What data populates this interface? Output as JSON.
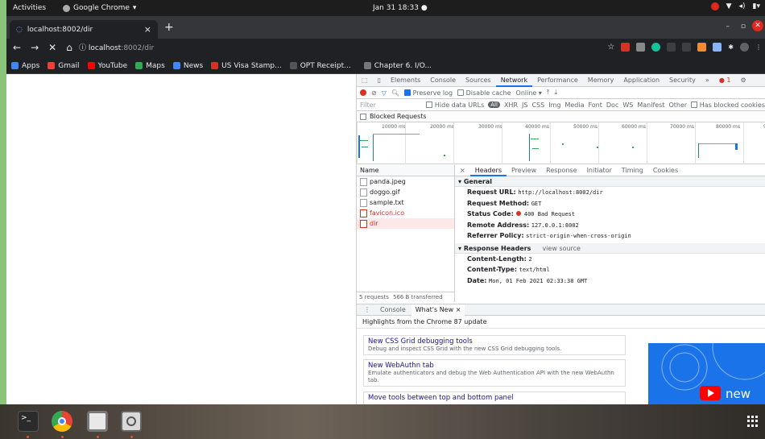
{
  "topbar": {
    "activities": "Activities",
    "app_name": "Google Chrome",
    "clock": "Jan 31  18:33"
  },
  "tab": {
    "title": "localhost:8002/dir",
    "close": "×",
    "new": "+"
  },
  "toolbar": {
    "back": "←",
    "forward": "→",
    "stop": "✕",
    "home": "⌂",
    "url_host": "localhost",
    "url_path": ":8002/dir"
  },
  "bookmarks": [
    {
      "label": "Apps",
      "color": "#4285f4"
    },
    {
      "label": "Gmail",
      "color": "#ea4335"
    },
    {
      "label": "YouTube",
      "color": "#ff0000"
    },
    {
      "label": "Maps",
      "color": "#34a853"
    },
    {
      "label": "News",
      "color": "#4285f4"
    },
    {
      "label": "US Visa Stamp...",
      "color": "#d93025"
    },
    {
      "label": "OPT Receipt...",
      "color": "#555555"
    },
    {
      "label": "Chapter 6. I/O...",
      "color": "#777777"
    }
  ],
  "devtools": {
    "tabs": [
      "Elements",
      "Console",
      "Sources",
      "Network",
      "Performance",
      "Memory",
      "Application",
      "Security",
      "»"
    ],
    "active_tab": "Network",
    "error_count": "1",
    "network_toolbar": {
      "preserve_log": "Preserve log",
      "disable_cache": "Disable cache",
      "throttle": "Online"
    },
    "filter": {
      "placeholder": "Filter",
      "hide_data_urls": "Hide data URLs",
      "all": "All",
      "types": [
        "XHR",
        "JS",
        "CSS",
        "Img",
        "Media",
        "Font",
        "Doc",
        "WS",
        "Manifest",
        "Other"
      ],
      "has_blocked": "Has blocked cookies"
    },
    "blocked_requests": "Blocked Requests",
    "timeline_ticks": [
      "10000 ms",
      "20000 ms",
      "30000 ms",
      "40000 ms",
      "50000 ms",
      "60000 ms",
      "70000 ms",
      "80000 ms",
      "9"
    ],
    "name_header": "Name",
    "requests": [
      {
        "name": "panda.jpeg",
        "error": false
      },
      {
        "name": "doggo.gif",
        "error": false
      },
      {
        "name": "sample.txt",
        "error": false
      },
      {
        "name": "favicon.ico",
        "error": true
      },
      {
        "name": "dir",
        "error": true
      }
    ],
    "summary_requests": "5 requests",
    "summary_transferred": "566 B transferred",
    "detail_tabs": [
      "×",
      "Headers",
      "Preview",
      "Response",
      "Initiator",
      "Timing",
      "Cookies"
    ],
    "general": {
      "title": "General",
      "request_url_k": "Request URL:",
      "request_url_v": "http://localhost:8002/dir",
      "method_k": "Request Method:",
      "method_v": "GET",
      "status_k": "Status Code:",
      "status_v": "400 Bad Request",
      "remote_k": "Remote Address:",
      "remote_v": "127.0.0.1:8002",
      "referrer_k": "Referrer Policy:",
      "referrer_v": "strict-origin-when-cross-origin"
    },
    "response_headers": {
      "title": "Response Headers",
      "view_source": "view source",
      "length_k": "Content-Length:",
      "length_v": "2",
      "type_k": "Content-Type:",
      "type_v": "text/html",
      "date_k": "Date:",
      "date_v": "Mon, 01 Feb 2021 02:33:38 GMT"
    },
    "drawer": {
      "tabs": [
        "Console",
        "What's New ×"
      ],
      "highlights": "Highlights from the Chrome 87 update",
      "cards": [
        {
          "title": "New CSS Grid debugging tools",
          "desc": "Debug and inspect CSS Grid with the new CSS Grid debugging tools."
        },
        {
          "title": "New WebAuthn tab",
          "desc": "Emulate authenticators and debug the Web Authentication API with the new WebAuthn tab."
        },
        {
          "title": "Move tools between top and bottom panel",
          "desc": ""
        }
      ],
      "promo_word": "new"
    }
  }
}
